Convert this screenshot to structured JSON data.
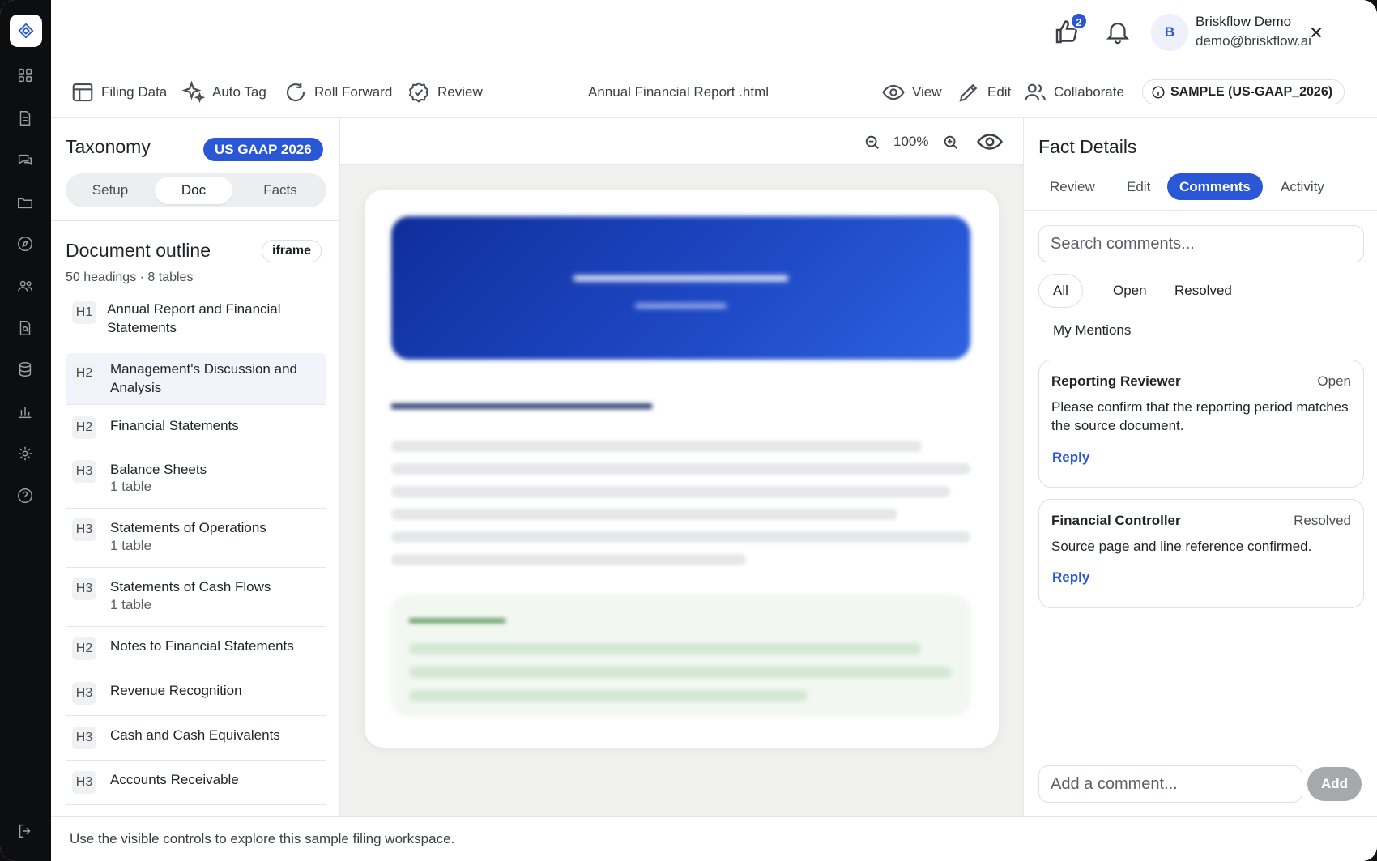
{
  "header": {
    "notif_count": "2",
    "avatar_initial": "B",
    "user_name": "Briskflow Demo",
    "user_email": "demo@briskflow.ai"
  },
  "toolbar": {
    "filing_data": "Filing Data",
    "auto_tag": "Auto Tag",
    "roll_forward": "Roll Forward",
    "review": "Review",
    "doc_title": "Annual Financial Report .html",
    "view": "View",
    "edit": "Edit",
    "collaborate": "Collaborate",
    "sample": "SAMPLE (US-GAAP_2026)"
  },
  "left": {
    "title": "Taxonomy",
    "taxonomy_badge": "US GAAP 2026",
    "segments": [
      "Setup",
      "Doc",
      "Facts"
    ],
    "active_segment": "Doc",
    "outline_title": "Document outline",
    "iframe_label": "iframe",
    "outline_summary": "50 headings · 8 tables",
    "outline": [
      {
        "level": "H1",
        "text": "Annual Report and Financial Statements",
        "sub": ""
      },
      {
        "level": "H2",
        "text": "Management's Discussion and Analysis",
        "sub": ""
      },
      {
        "level": "H2",
        "text": "Financial Statements",
        "sub": ""
      },
      {
        "level": "H3",
        "text": "Balance Sheets",
        "sub": "1 table"
      },
      {
        "level": "H3",
        "text": "Statements of Operations",
        "sub": "1 table"
      },
      {
        "level": "H3",
        "text": "Statements of Cash Flows",
        "sub": "1 table"
      },
      {
        "level": "H2",
        "text": "Notes to Financial Statements",
        "sub": ""
      },
      {
        "level": "H3",
        "text": "Revenue Recognition",
        "sub": ""
      },
      {
        "level": "H3",
        "text": "Cash and Cash Equivalents",
        "sub": ""
      },
      {
        "level": "H3",
        "text": "Accounts Receivable",
        "sub": ""
      }
    ]
  },
  "center": {
    "zoom": "100%"
  },
  "right": {
    "title": "Fact Details",
    "tabs": [
      "Review",
      "Edit",
      "Comments",
      "Activity"
    ],
    "active_tab": "Comments",
    "search_placeholder": "Search comments...",
    "filters": [
      "All",
      "Open",
      "Resolved"
    ],
    "mentions": "My Mentions",
    "comments": [
      {
        "author": "Reporting Reviewer",
        "status": "Open",
        "body": "Please confirm that the reporting period matches the source document.",
        "reply": "Reply"
      },
      {
        "author": "Financial Controller",
        "status": "Resolved",
        "body": "Source page and line reference confirmed.",
        "reply": "Reply"
      }
    ],
    "add_placeholder": "Add a comment...",
    "add_label": "Add"
  },
  "footer": {
    "text": "Use the visible controls to explore this sample filing workspace."
  },
  "colors": {
    "accent": "#2a57d6",
    "rail": "#0d0e10"
  }
}
